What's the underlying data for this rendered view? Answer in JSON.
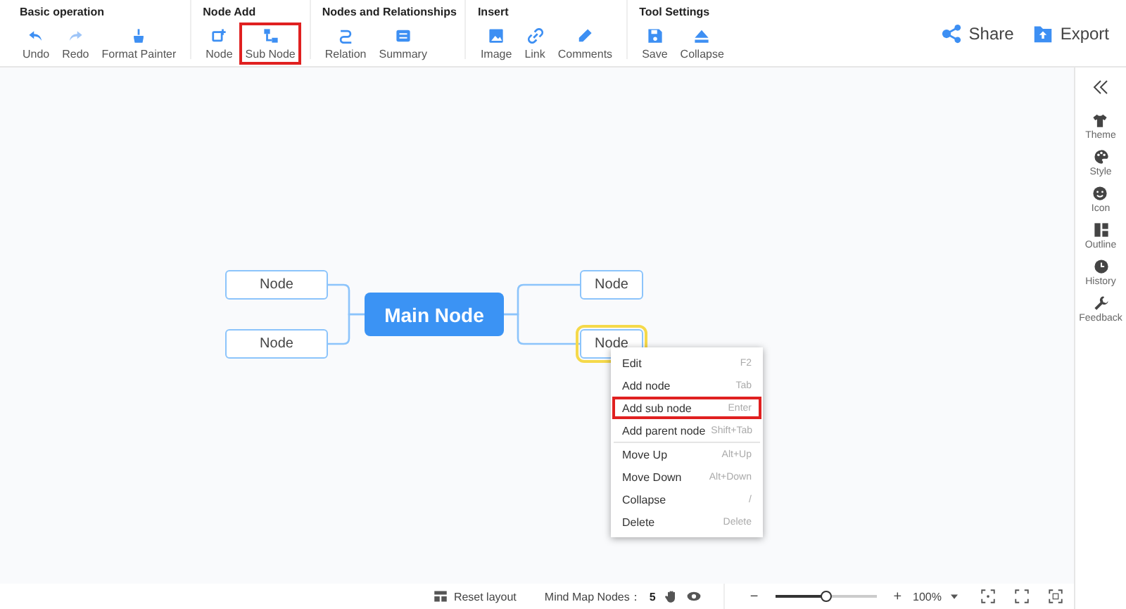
{
  "toolbar": {
    "groups": [
      {
        "title": "Basic operation",
        "tools": [
          {
            "label": "Undo",
            "highlighted": false
          },
          {
            "label": "Redo",
            "highlighted": false
          },
          {
            "label": "Format Painter",
            "highlighted": false
          }
        ]
      },
      {
        "title": "Node Add",
        "tools": [
          {
            "label": "Node",
            "highlighted": false
          },
          {
            "label": "Sub Node",
            "highlighted": true
          }
        ]
      },
      {
        "title": "Nodes and Relationships",
        "tools": [
          {
            "label": "Relation",
            "highlighted": false
          },
          {
            "label": "Summary",
            "highlighted": false
          }
        ]
      },
      {
        "title": "Insert",
        "tools": [
          {
            "label": "Image",
            "highlighted": false
          },
          {
            "label": "Link",
            "highlighted": false
          },
          {
            "label": "Comments",
            "highlighted": false
          }
        ]
      },
      {
        "title": "Tool Settings",
        "tools": [
          {
            "label": "Save",
            "highlighted": false
          },
          {
            "label": "Collapse",
            "highlighted": false
          }
        ]
      }
    ],
    "actions": [
      {
        "label": "Share"
      },
      {
        "label": "Export"
      }
    ]
  },
  "mind_map": {
    "main_node": {
      "label": "Main Node"
    },
    "left_nodes": [
      {
        "label": "Node",
        "selected": false
      },
      {
        "label": "Node",
        "selected": false
      }
    ],
    "right_nodes": [
      {
        "label": "Node",
        "selected": false
      },
      {
        "label": "Node",
        "selected": true
      }
    ]
  },
  "context_menu": {
    "items": [
      {
        "label": "Edit",
        "shortcut": "F2",
        "highlighted": false,
        "divider_after": false
      },
      {
        "label": "Add node",
        "shortcut": "Tab",
        "highlighted": false,
        "divider_after": false
      },
      {
        "label": "Add sub node",
        "shortcut": "Enter",
        "highlighted": true,
        "divider_after": false
      },
      {
        "label": "Add parent node",
        "shortcut": "Shift+Tab",
        "highlighted": false,
        "divider_after": true
      },
      {
        "label": "Move Up",
        "shortcut": "Alt+Up",
        "highlighted": false,
        "divider_after": false
      },
      {
        "label": "Move Down",
        "shortcut": "Alt+Down",
        "highlighted": false,
        "divider_after": false
      },
      {
        "label": "Collapse",
        "shortcut": "/",
        "highlighted": false,
        "divider_after": false
      },
      {
        "label": "Delete",
        "shortcut": "Delete",
        "highlighted": false,
        "divider_after": false
      }
    ]
  },
  "sidebar": {
    "items": [
      {
        "label": "Theme"
      },
      {
        "label": "Style"
      },
      {
        "label": "Icon"
      },
      {
        "label": "Outline"
      },
      {
        "label": "History"
      },
      {
        "label": "Feedback"
      }
    ]
  },
  "status_bar": {
    "reset_label": "Reset layout",
    "nodes_label": "Mind Map Nodes：",
    "nodes_count": "5",
    "zoom_minus": "−",
    "zoom": {
      "level": 0.5
    },
    "zoom_plus": "+",
    "zoom_value": "100%"
  }
}
